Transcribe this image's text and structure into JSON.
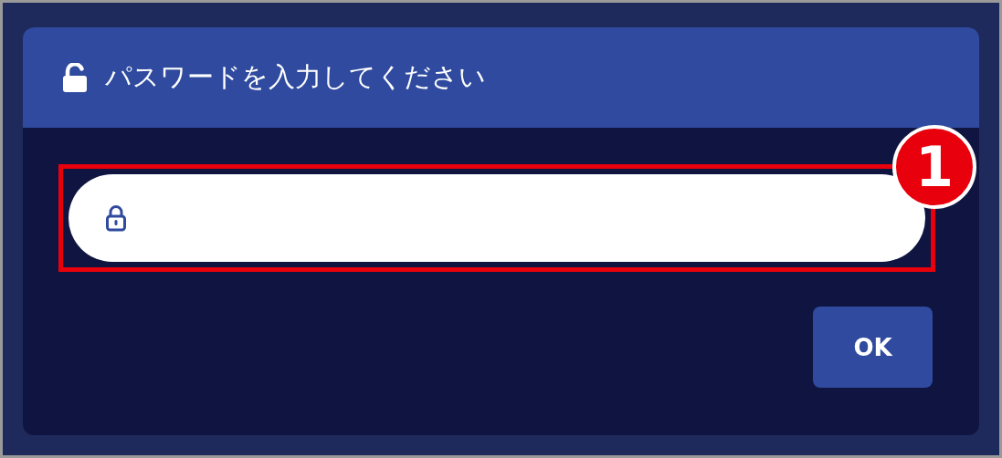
{
  "dialog": {
    "title": "パスワードを入力してください"
  },
  "password_field": {
    "highlighted": true,
    "badge": "1"
  },
  "buttons": [
    {
      "label": "OK"
    }
  ]
}
